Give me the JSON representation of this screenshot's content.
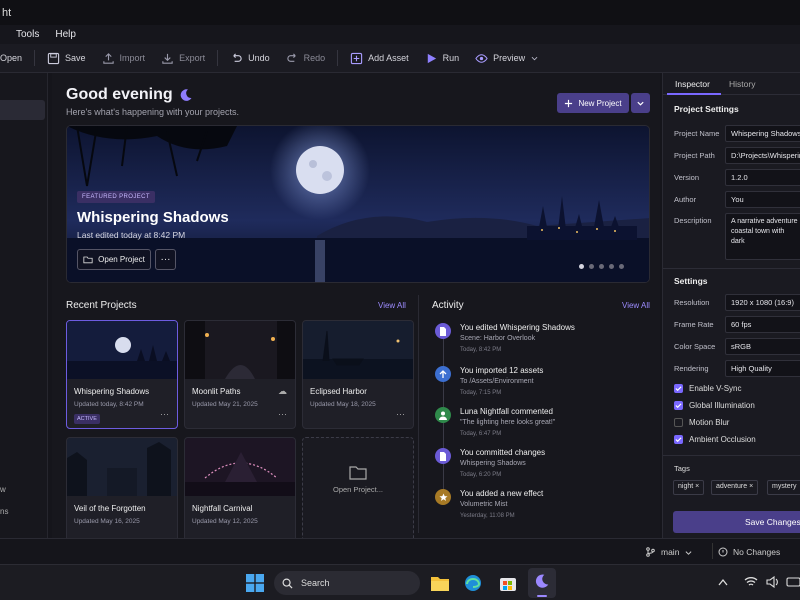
{
  "app": {
    "title_fragment": "ht"
  },
  "menu": [
    "Tools",
    "Help"
  ],
  "toolbar": {
    "open": "Open",
    "save": "Save",
    "import": "Import",
    "export": "Export",
    "undo": "Undo",
    "redo": "Redo",
    "add_asset": "Add Asset",
    "run": "Run",
    "preview": "Preview"
  },
  "sidebar": {
    "frag1": "w",
    "frag2": "ns"
  },
  "main": {
    "greeting": "Good evening",
    "subtitle": "Here's what's happening with your projects.",
    "new_project": "New Project",
    "featured": {
      "badge": "FEATURED PROJECT",
      "title": "Whispering Shadows",
      "edited": "Last edited today at 8:42 PM",
      "open": "Open Project",
      "more": "···"
    },
    "recent": {
      "title": "Recent Projects",
      "view_all": "View All",
      "cards": [
        {
          "name": "Whispering Shadows",
          "date": "Updated today, 8:42 PM",
          "badge": "ACTIVE"
        },
        {
          "name": "Moonlit Paths",
          "date": "Updated May 21, 2025"
        },
        {
          "name": "Eclipsed Harbor",
          "date": "Updated May 18, 2025"
        },
        {
          "name": "Veil of the Forgotten",
          "date": "Updated May 16, 2025"
        },
        {
          "name": "Nightfall Carnival",
          "date": "Updated May 12, 2025"
        }
      ],
      "open_project": "Open Project..."
    },
    "activity": {
      "title": "Activity",
      "view_all": "View All",
      "items": [
        {
          "title": "You edited Whispering Shadows",
          "detail": "Scene: Harbor Overlook",
          "time": "Today, 8:42 PM",
          "color": "#6b5bd6"
        },
        {
          "title": "You imported 12 assets",
          "detail": "To /Assets/Environment",
          "time": "Today, 7:15 PM",
          "color": "#3c6fd1"
        },
        {
          "title": "Luna Nightfall commented",
          "detail": "\"The lighting here looks great!\"",
          "time": "Today, 6:47 PM",
          "color": "#2f8a4b"
        },
        {
          "title": "You committed changes",
          "detail": "Whispering Shadows",
          "time": "Today, 6:20 PM",
          "color": "#6b5bd6"
        },
        {
          "title": "You added a new effect",
          "detail": "Volumetric Mist",
          "time": "Yesterday, 11:08 PM",
          "color": "#a77a25"
        }
      ]
    }
  },
  "inspector": {
    "tabs": [
      "Inspector",
      "History"
    ],
    "project_settings": "Project Settings",
    "fields": [
      {
        "label": "Project Name",
        "value": "Whispering Shadows"
      },
      {
        "label": "Project Path",
        "value": "D:\\Projects\\Whispering"
      },
      {
        "label": "Version",
        "value": "1.2.0"
      },
      {
        "label": "Author",
        "value": "You"
      }
    ],
    "description_label": "Description",
    "description": "A narrative adventure coastal town with dark",
    "settings": "Settings",
    "settings_fields": [
      {
        "label": "Resolution",
        "value": "1920 x 1080 (16:9)"
      },
      {
        "label": "Frame Rate",
        "value": "60 fps"
      },
      {
        "label": "Color Space",
        "value": "sRGB"
      },
      {
        "label": "Rendering",
        "value": "High Quality"
      }
    ],
    "checks": [
      {
        "label": "Enable V-Sync",
        "checked": true
      },
      {
        "label": "Global Illumination",
        "checked": true
      },
      {
        "label": "Motion Blur",
        "checked": false
      },
      {
        "label": "Ambient Occlusion",
        "checked": true
      }
    ],
    "tags_label": "Tags",
    "tags": [
      "night",
      "adventure",
      "mystery"
    ],
    "save": "Save Changes"
  },
  "status": {
    "branch": "main",
    "changes": "No Changes"
  },
  "taskbar": {
    "search": "Search"
  },
  "colors": {
    "accent": "#7a68ff",
    "button": "#4a3f8a"
  }
}
